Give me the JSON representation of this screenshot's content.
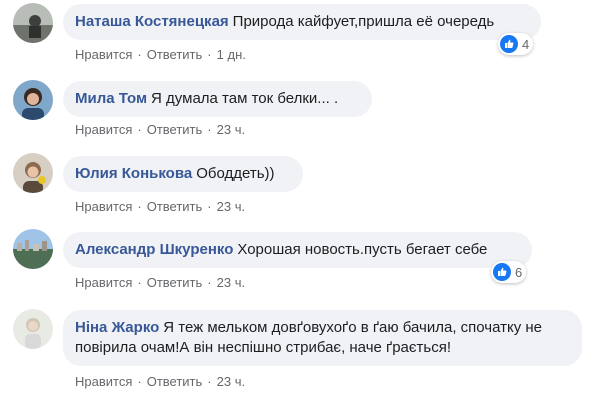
{
  "comments": [
    {
      "author": "Наташа Костянецкая",
      "text": "Природа кайфует,пришла её очередь",
      "like": "Нравится",
      "reply": "Ответить",
      "time": "1 дн.",
      "reactions": "4"
    },
    {
      "author": "Мила Том",
      "text": "Я думала там ток белки... .",
      "like": "Нравится",
      "reply": "Ответить",
      "time": "23 ч."
    },
    {
      "author": "Юлия Конькова",
      "text": "Ободдеть))",
      "like": "Нравится",
      "reply": "Ответить",
      "time": "23 ч."
    },
    {
      "author": "Александр Шкуренко",
      "text": "Хорошая новость.пусть бегает себе",
      "like": "Нравится",
      "reply": "Ответить",
      "time": "23 ч.",
      "reactions": "6"
    },
    {
      "author": "Ніна Жарко",
      "text": "Я теж мельком довґовухоґо в ґаю бачила, спочатку не повірила очам!А він неспішно стрибає, наче ґрається!",
      "like": "Нравится",
      "reply": "Ответить",
      "time": "23 ч."
    }
  ],
  "colors": {
    "author": "#385898",
    "bubble": "#f0f2f5",
    "meta": "#65676b",
    "like_icon": "#1877f2"
  },
  "icons": {
    "reaction": "thumbs-up-icon"
  }
}
